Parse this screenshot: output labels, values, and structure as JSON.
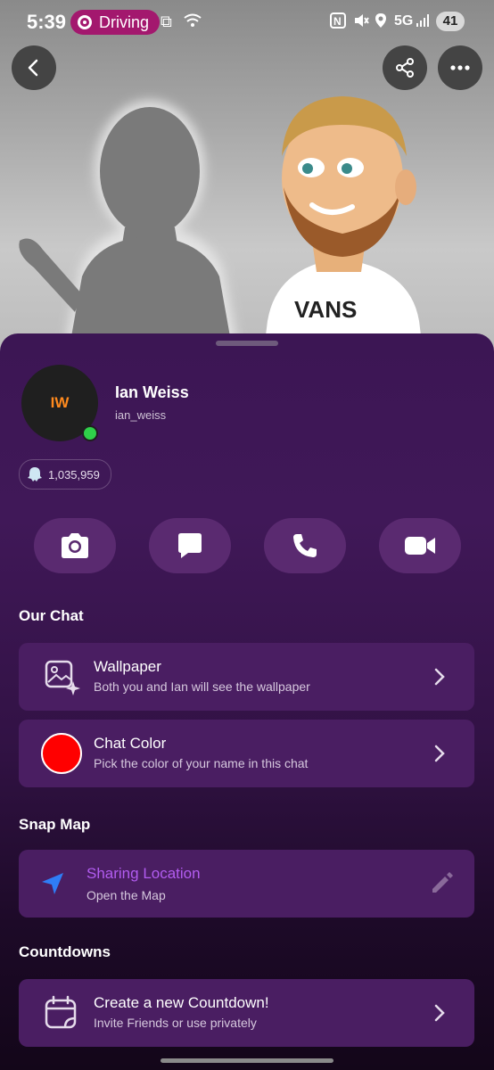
{
  "status": {
    "time": "5:39",
    "driving_label": "Driving",
    "network": "5G",
    "battery": "41"
  },
  "profile": {
    "initials": "IW",
    "name": "Ian Weiss",
    "username": "ian_weiss",
    "snapscore": "1,035,959"
  },
  "actions": [
    "camera-icon",
    "chat-icon",
    "phone-icon",
    "video-icon"
  ],
  "our_chat": {
    "heading": "Our Chat",
    "wallpaper_title": "Wallpaper",
    "wallpaper_sub": "Both you and Ian will see the wallpaper",
    "color_title": "Chat Color",
    "color_sub": "Pick the color of your name in this chat",
    "chat_color": "#ff0000"
  },
  "snap_map": {
    "heading": "Snap Map",
    "title": "Sharing Location",
    "sub": "Open the Map",
    "accent": "#b25cf0"
  },
  "countdowns": {
    "heading": "Countdowns",
    "title": "Create a new Countdown!",
    "sub": "Invite Friends or use privately"
  },
  "avatar_shirt_text": "VANS"
}
